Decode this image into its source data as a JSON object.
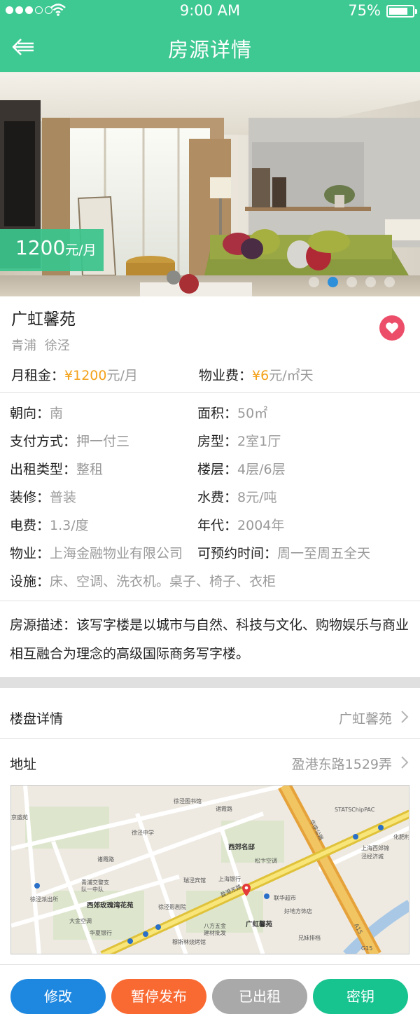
{
  "status_bar": {
    "time": "9:00 AM",
    "battery": "75%"
  },
  "header": {
    "title": "房源详情"
  },
  "hero": {
    "price": "1200",
    "price_unit": "元/月",
    "slide_count": 5,
    "active_slide": 2
  },
  "listing": {
    "name": "广虹馨苑",
    "district": "青浦",
    "area": "徐泾",
    "rent_label": "月租金：",
    "rent_value": "¥1200",
    "rent_unit": "元/月",
    "fee_label": "物业费：",
    "fee_value": "¥6",
    "fee_unit": "元/㎡天"
  },
  "attributes": {
    "orientation": {
      "label": "朝向：",
      "value": "南"
    },
    "area_size": {
      "label": "面积：",
      "value": "50㎡"
    },
    "payment": {
      "label": "支付方式：",
      "value": "押一付三"
    },
    "layout": {
      "label": "房型：",
      "value": "2室1厅"
    },
    "rent_type": {
      "label": "出租类型：",
      "value": "整租"
    },
    "floor": {
      "label": "楼层：",
      "value": "4层/6层"
    },
    "decoration": {
      "label": "装修：",
      "value": "普装"
    },
    "water": {
      "label": "水费：",
      "value": "8元/吨"
    },
    "electric": {
      "label": "电费：",
      "value": "1.3/度"
    },
    "year": {
      "label": "年代：",
      "value": "2004年"
    },
    "property_co": {
      "label": "物业：",
      "value": "上海金融物业有限公司"
    },
    "visit_time": {
      "label": "可预约时间：",
      "value": "周一至周五全天"
    },
    "facilities": {
      "label": "设施：",
      "value": "床、空调、洗衣机。桌子、椅子、衣柜"
    }
  },
  "description": "房源描述：该写字楼是以城市与自然、科技与文化、购物娱乐与商业相互融合为理念的高级国际商务写字楼。",
  "details": [
    {
      "label": "楼盘详情",
      "value": "广虹馨苑"
    },
    {
      "label": "地址",
      "value": "盈港东路1529弄"
    }
  ],
  "map": {
    "labels": [
      "徐泾图书馆",
      "诸霞路",
      "京盛苑",
      "徐泾中学",
      "西郊名邸",
      "STATSChipPAC",
      "上海西郊锦",
      "泾经济城",
      "化肥村",
      "松卞空调",
      "诸霞路",
      "青浦交警支",
      "队一中队",
      "徐泾派出所",
      "瑞泾宾馆",
      "上海银行",
      "联华超市",
      "西郊玫瑰湾花苑",
      "徐泾影剧院",
      "好地方饰店",
      "大金空调",
      "八方五金",
      "建材批发",
      "广虹馨苑",
      "华夏银行",
      "穆斯林烧烤馆",
      "兄妹排档",
      "华徐公路",
      "盈港东路",
      "G15",
      "A15"
    ]
  },
  "actions": {
    "edit": "修改",
    "pause": "暂停发布",
    "rented": "已出租",
    "key": "密钥"
  },
  "colors": {
    "primary": "#3ec892",
    "price": "#f3a21b",
    "favorite": "#ec4e6a",
    "edit": "#1e88e0",
    "pause": "#f96a33",
    "rented": "#a9a9a9",
    "key": "#17c38f"
  }
}
